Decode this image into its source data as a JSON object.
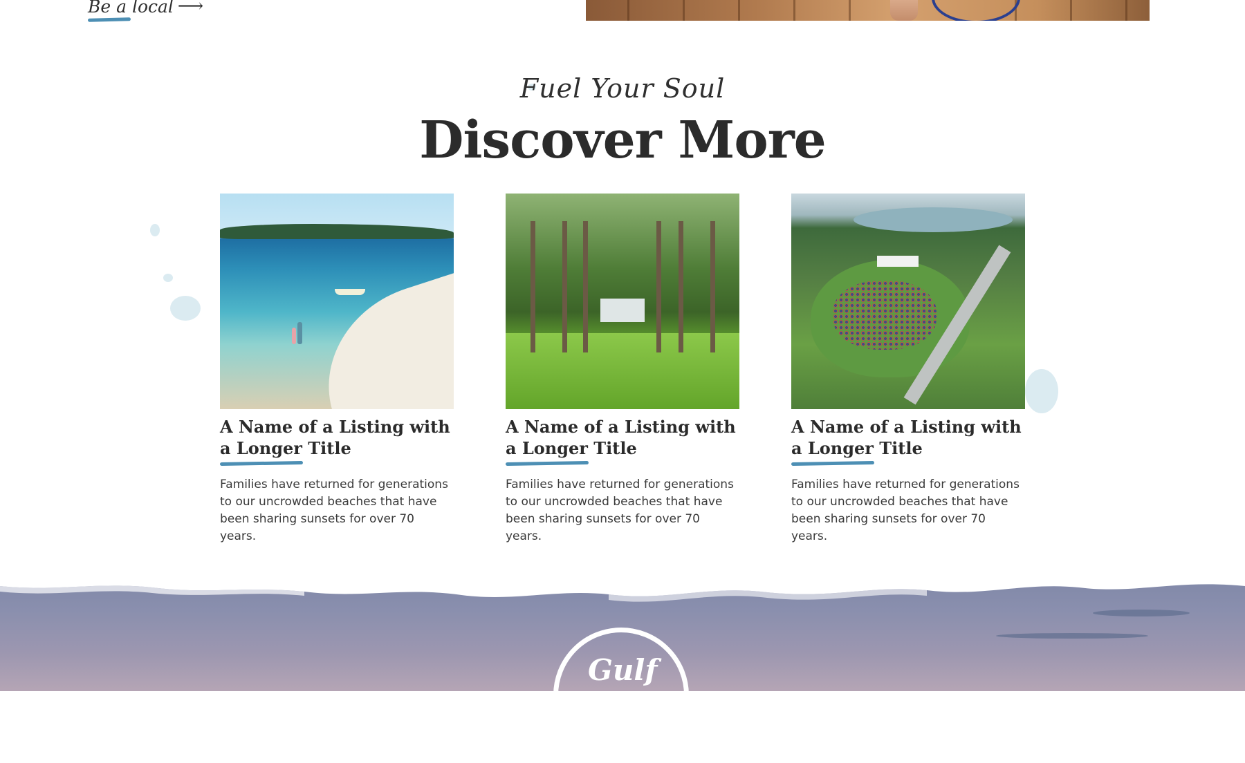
{
  "top": {
    "be_local_label": "Be a local",
    "be_local_arrow": "⟶"
  },
  "section": {
    "eyebrow": "Fuel Your Soul",
    "heading": "Discover More"
  },
  "cards": [
    {
      "image": "beach-sandbar-photo",
      "title": "A Name of a Listing with a Longer Title",
      "description": "Families have returned for generations to our uncrowded beaches that have been sharing sunsets for over 70 years."
    },
    {
      "image": "palm-alley-photo",
      "title": "A Name of a Listing with a Longer Title",
      "description": "Families have returned for generations to our uncrowded beaches that have been sharing sunsets for over 70 years."
    },
    {
      "image": "aerial-concert-photo",
      "title": "A Name of a Listing with a Longer Title",
      "description": "Families have returned for generations to our uncrowded beaches that have been sharing sunsets for over 70 years."
    }
  ],
  "footer": {
    "logo_text": "Gulf"
  },
  "colors": {
    "accent": "#4d8fb4",
    "heading": "#2b2b2b",
    "footer": "#7d86a6"
  }
}
